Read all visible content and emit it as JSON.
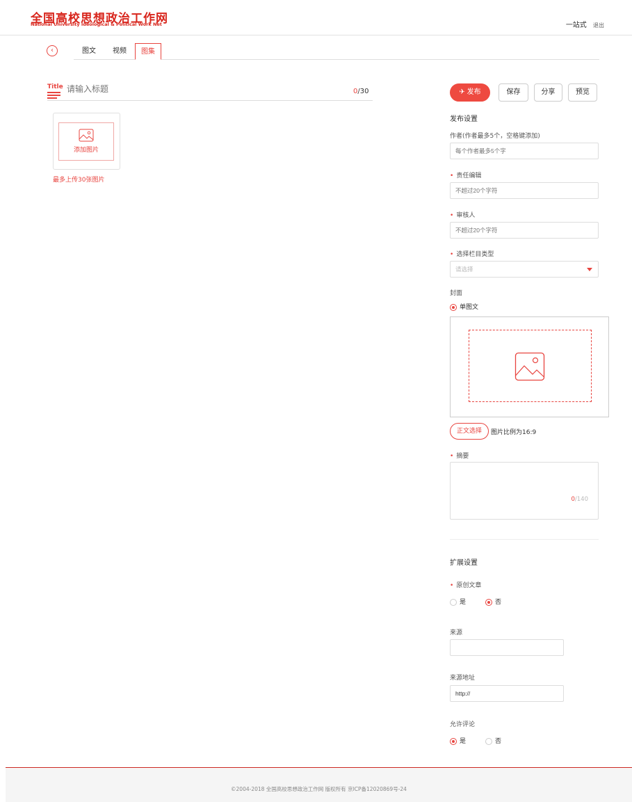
{
  "header": {
    "logo_cn": "全国高校思想政治工作网",
    "logo_en": "National University Ideological & Political Work Net",
    "user_link": "一站式",
    "logout": "退出"
  },
  "tabs": [
    {
      "label": "图文",
      "active": false
    },
    {
      "label": "视频",
      "active": false
    },
    {
      "label": "图集",
      "active": true
    }
  ],
  "editor": {
    "title_icon": "Title",
    "title_placeholder": "请输入标题",
    "count_current": "0",
    "count_max": "/30",
    "upload_label": "添加图片",
    "upload_tip": "最多上传30张图片"
  },
  "actions": {
    "publish": "发布",
    "save": "保存",
    "share": "分享",
    "preview": "预览"
  },
  "publish_settings": {
    "title": "发布设置",
    "author_label": "作者(作者最多5个，空格键添加)",
    "author_placeholder": "每个作者最多5个字",
    "editor_label": "责任编辑",
    "editor_placeholder": "不超过20个字符",
    "reviewer_label": "审核人",
    "reviewer_placeholder": "不超过20个字符",
    "column_label": "选择栏目类型",
    "column_placeholder": "请选择",
    "cover_label": "封面",
    "cover_option": "单图文",
    "cover_button": "正文选择",
    "cover_ratio": "图片比例为16:9",
    "summary_label": "摘要",
    "summary_count_current": "0",
    "summary_count_max": "/140"
  },
  "extended_settings": {
    "title": "扩展设置",
    "original_label": "原创文章",
    "original_yes": "是",
    "original_no": "否",
    "original_selected": "否",
    "source_label": "来源",
    "source_value": "",
    "source_url_label": "来源地址",
    "source_url_value": "http://",
    "comments_label": "允许评论",
    "comments_yes": "是",
    "comments_no": "否",
    "comments_selected": "是"
  },
  "footer": {
    "copyright": "©2004-2018 全国高校思想政治工作网 版权所有 京ICP备12020869号-24"
  },
  "colors": {
    "accent": "#e8443f",
    "brand": "#d8251c",
    "footer_bg": "#f5f5f5"
  }
}
